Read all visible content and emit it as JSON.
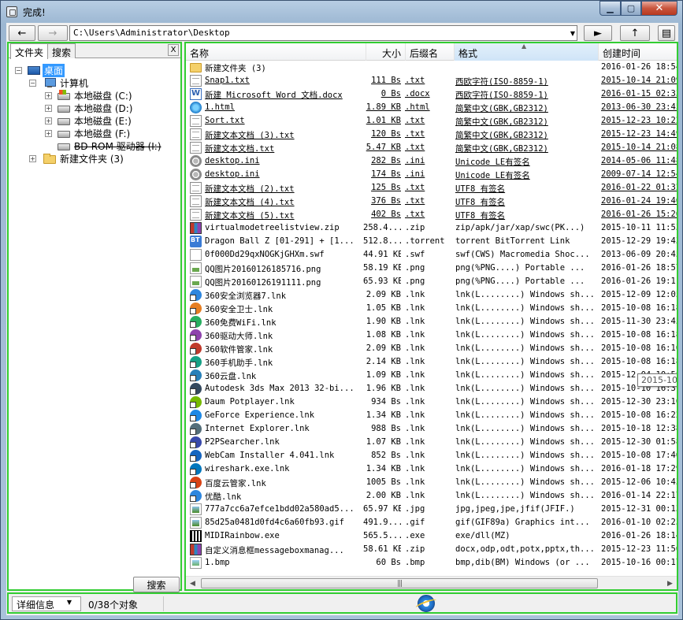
{
  "window": {
    "title": "完成!"
  },
  "toolbar": {
    "address": "C:\\Users\\Administrator\\Desktop"
  },
  "left_pane": {
    "tabs": [
      {
        "label": "文件夹"
      },
      {
        "label": "搜索"
      }
    ],
    "close_label": "X",
    "tree": [
      {
        "label": "桌面",
        "level": 0,
        "icon": "desktop-icon",
        "expander": "−",
        "selected": true
      },
      {
        "label": "计算机",
        "level": 1,
        "icon": "computer-icon",
        "expander": "−"
      },
      {
        "label": "本地磁盘 (C:)",
        "level": 2,
        "icon": "drive-icon",
        "expander": "+"
      },
      {
        "label": "本地磁盘 (D:)",
        "level": 2,
        "icon": "drive-icon",
        "expander": "+"
      },
      {
        "label": "本地磁盘 (E:)",
        "level": 2,
        "icon": "drive-icon",
        "expander": "+"
      },
      {
        "label": "本地磁盘 (F:)",
        "level": 2,
        "icon": "drive-icon",
        "expander": "+"
      },
      {
        "label": "BD-ROM 驱动器 (I:)",
        "level": 2,
        "icon": "optical-drive-icon",
        "expander": "",
        "struck": true
      },
      {
        "label": "新建文件夹 (3)",
        "level": 1,
        "icon": "folder-icon",
        "expander": "+"
      }
    ],
    "search_button": "搜索"
  },
  "list": {
    "columns": [
      "名称",
      "大小",
      "后缀名",
      "格式",
      "创建时间"
    ],
    "tooltip": "2015-10-08",
    "rows": [
      {
        "icon": "folder-icon",
        "name": "新建文件夹 (3)",
        "size": "",
        "ext": "",
        "format": "",
        "date": "2016-01-26 18:54",
        "ul": false
      },
      {
        "icon": "txt-icon",
        "name": "Snap1.txt",
        "size": "111 Bs",
        "ext": ".txt",
        "format": "西欧字符(ISO-8859-1)",
        "date": "2015-10-14 21:09",
        "ul": true
      },
      {
        "icon": "docx-icon",
        "name": "新建 Microsoft Word 文档.docx",
        "size": "0 Bs",
        "ext": ".docx",
        "format": "西欧字符(ISO-8859-1)",
        "date": "2016-01-15 02:33",
        "ul": true
      },
      {
        "icon": "html-icon",
        "name": "1.html",
        "size": "1.89 KB",
        "ext": ".html",
        "format": "简繁中文(GBK,GB2312)",
        "date": "2013-06-30 23:45",
        "ul": true
      },
      {
        "icon": "txt-icon",
        "name": "Sort.txt",
        "size": "1.01 KB",
        "ext": ".txt",
        "format": "简繁中文(GBK,GB2312)",
        "date": "2015-12-23 10:22",
        "ul": true
      },
      {
        "icon": "txt-icon",
        "name": "新建文本文档 (3).txt",
        "size": "120 Bs",
        "ext": ".txt",
        "format": "简繁中文(GBK,GB2312)",
        "date": "2015-12-23 14:49",
        "ul": true
      },
      {
        "icon": "txt-icon",
        "name": "新建文本文档.txt",
        "size": "5.47 KB",
        "ext": ".txt",
        "format": "简繁中文(GBK,GB2312)",
        "date": "2015-10-14 21:08",
        "ul": true
      },
      {
        "icon": "ini-icon",
        "name": "desktop.ini",
        "size": "282 Bs",
        "ext": ".ini",
        "format": "Unicode LE有签名",
        "date": "2014-05-06 11:48",
        "ul": true
      },
      {
        "icon": "ini-icon",
        "name": "desktop.ini",
        "size": "174 Bs",
        "ext": ".ini",
        "format": "Unicode LE有签名",
        "date": "2009-07-14 12:54",
        "ul": true
      },
      {
        "icon": "txt-icon",
        "name": "新建文本文档 (2).txt",
        "size": "125 Bs",
        "ext": ".txt",
        "format": "UTF8 有签名",
        "date": "2016-01-22 01:32",
        "ul": true
      },
      {
        "icon": "txt-icon",
        "name": "新建文本文档 (4).txt",
        "size": "376 Bs",
        "ext": ".txt",
        "format": "UTF8 有签名",
        "date": "2016-01-24 19:46",
        "ul": true
      },
      {
        "icon": "txt-icon",
        "name": "新建文本文档 (5).txt",
        "size": "402 Bs",
        "ext": ".txt",
        "format": "UTF8 有签名",
        "date": "2016-01-26 15:26",
        "ul": true
      },
      {
        "icon": "zip-icon",
        "name": "virtualmodetreelistview.zip",
        "size": "258.4...",
        "ext": ".zip",
        "format": "zip/apk/jar/xap/swc(PK...)",
        "date": "2015-10-11 11:53",
        "ul": false
      },
      {
        "icon": "torrent-icon",
        "name": "Dragon Ball Z [01-291] + [1...",
        "size": "512.8...",
        "ext": ".torrent",
        "format": "torrent  BitTorrent Link",
        "date": "2015-12-29 19:43",
        "ul": false
      },
      {
        "icon": "swf-icon",
        "name": "0f000Dd29qxNOGKjGHXm.swf",
        "size": "44.91 KB",
        "ext": ".swf",
        "format": "swf(CWS)  Macromedia Shoc...",
        "date": "2013-06-09 20:45",
        "ul": false
      },
      {
        "icon": "png-icon",
        "name": "QQ图片20160126185716.png",
        "size": "58.19 KB",
        "ext": ".png",
        "format": "png(%PNG....)  Portable ...",
        "date": "2016-01-26 18:57",
        "ul": false
      },
      {
        "icon": "png-icon",
        "name": "QQ图片20160126191111.png",
        "size": "65.93 KB",
        "ext": ".png",
        "format": "png(%PNG....)  Portable ...",
        "date": "2016-01-26 19:11",
        "ul": false
      },
      {
        "icon": "shortcut-360browser-icon",
        "name": "360安全浏览器7.lnk",
        "size": "2.09 KB",
        "ext": ".lnk",
        "format": "lnk(L........)  Windows sh...",
        "date": "2015-12-09 12:05",
        "ul": false
      },
      {
        "icon": "shortcut-360guard-icon",
        "name": "360安全卫士.lnk",
        "size": "1.05 KB",
        "ext": ".lnk",
        "format": "lnk(L........)  Windows sh...",
        "date": "2015-10-08 16:18",
        "ul": false
      },
      {
        "icon": "shortcut-360wifi-icon",
        "name": "360免费WiFi.lnk",
        "size": "1.90 KB",
        "ext": ".lnk",
        "format": "lnk(L........)  Windows sh...",
        "date": "2015-11-30 23:45",
        "ul": false
      },
      {
        "icon": "shortcut-360driver-icon",
        "name": "360驱动大师.lnk",
        "size": "1.08 KB",
        "ext": ".lnk",
        "format": "lnk(L........)  Windows sh...",
        "date": "2015-10-08 16:18",
        "ul": false
      },
      {
        "icon": "shortcut-360software-icon",
        "name": "360软件管家.lnk",
        "size": "2.09 KB",
        "ext": ".lnk",
        "format": "lnk(L........)  Windows sh...",
        "date": "2015-10-08 16:16",
        "ul": false
      },
      {
        "icon": "shortcut-360mobile-icon",
        "name": "360手机助手.lnk",
        "size": "2.14 KB",
        "ext": ".lnk",
        "format": "lnk(L........)  Windows sh...",
        "date": "2015-10-08 16:18",
        "ul": false
      },
      {
        "icon": "shortcut-360cloud-icon",
        "name": "360云盘.lnk",
        "size": "1.09 KB",
        "ext": ".lnk",
        "format": "lnk(L........)  Windows sh...",
        "date": "2015-12-04 10:58",
        "ul": false
      },
      {
        "icon": "shortcut-3dsmax-icon",
        "name": "Autodesk 3ds Max 2013 32-bi...",
        "size": "1.96 KB",
        "ext": ".lnk",
        "format": "lnk(L........)  Windows sh...",
        "date": "2015-10-10 16:37",
        "ul": false
      },
      {
        "icon": "shortcut-potplayer-icon",
        "name": "Daum Potplayer.lnk",
        "size": "934 Bs",
        "ext": ".lnk",
        "format": "lnk(L........)  Windows sh...",
        "date": "2015-12-30 23:10",
        "ul": false
      },
      {
        "icon": "shortcut-geforce-icon",
        "name": "GeForce Experience.lnk",
        "size": "1.34 KB",
        "ext": ".lnk",
        "format": "lnk(L........)  Windows sh...",
        "date": "2015-10-08 16:22",
        "ul": false
      },
      {
        "icon": "shortcut-ie-icon",
        "name": "Internet Explorer.lnk",
        "size": "988 Bs",
        "ext": ".lnk",
        "format": "lnk(L........)  Windows sh...",
        "date": "2015-10-18 12:38",
        "ul": false
      },
      {
        "icon": "shortcut-p2psearcher-icon",
        "name": "P2PSearcher.lnk",
        "size": "1.07 KB",
        "ext": ".lnk",
        "format": "lnk(L........)  Windows sh...",
        "date": "2015-12-30 01:58",
        "ul": false
      },
      {
        "icon": "shortcut-webcam-icon",
        "name": "WebCam Installer 4.041.lnk",
        "size": "852 Bs",
        "ext": ".lnk",
        "format": "lnk(L........)  Windows sh...",
        "date": "2015-10-08 17:46",
        "ul": false
      },
      {
        "icon": "shortcut-wireshark-icon",
        "name": "wireshark.exe.lnk",
        "size": "1.34 KB",
        "ext": ".lnk",
        "format": "lnk(L........)  Windows sh...",
        "date": "2016-01-18 17:29",
        "ul": false
      },
      {
        "icon": "shortcut-baiduyun-icon",
        "name": "百度云管家.lnk",
        "size": "1005 Bs",
        "ext": ".lnk",
        "format": "lnk(L........)  Windows sh...",
        "date": "2015-12-06 10:43",
        "ul": false
      },
      {
        "icon": "shortcut-youku-icon",
        "name": "优酷.lnk",
        "size": "2.00 KB",
        "ext": ".lnk",
        "format": "lnk(L........)  Windows sh...",
        "date": "2016-01-14 22:17",
        "ul": false
      },
      {
        "icon": "jpg-icon",
        "name": "777a7cc6a7efce1bdd02a580ad5...",
        "size": "65.97 KB",
        "ext": ".jpg",
        "format": "jpg,jpeg,jpe,jfif(JFIF.)",
        "date": "2015-12-31 00:13",
        "ul": false
      },
      {
        "icon": "gif-icon",
        "name": "85d25a0481d0fd4c6a60fb93.gif",
        "size": "491.9...",
        "ext": ".gif",
        "format": "gif(GIF89a)  Graphics int...",
        "date": "2016-01-10 02:23",
        "ul": false
      },
      {
        "icon": "exe-icon",
        "name": "MIDIRainbow.exe",
        "size": "565.5...",
        "ext": ".exe",
        "format": "exe/dll(MZ)",
        "date": "2016-01-26 18:14",
        "ul": false
      },
      {
        "icon": "zip-icon",
        "name": "自定义消息框messageboxmanag...",
        "size": "58.61 KB",
        "ext": ".zip",
        "format": "docx,odp,odt,potx,pptx,th...",
        "date": "2015-12-23 11:56",
        "ul": false
      },
      {
        "icon": "bmp-icon",
        "name": "1.bmp",
        "size": "60 Bs",
        "ext": ".bmp",
        "format": "bmp,dib(BM)  Windows (or ...",
        "date": "2015-10-16 00:17",
        "ul": false
      }
    ]
  },
  "statusbar": {
    "view_mode": "详细信息",
    "count_text": "0/38个对象"
  }
}
